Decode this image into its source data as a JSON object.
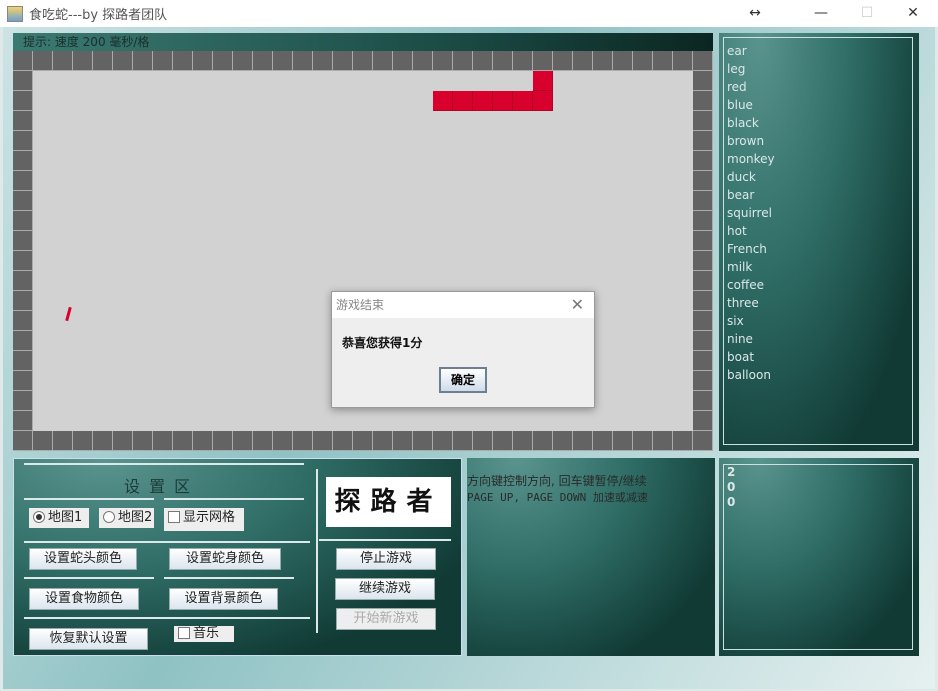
{
  "window": {
    "title": "食吃蛇---by 探路者团队",
    "resize_icon": "↔",
    "minimize_icon": "—",
    "maximize_icon": "☐",
    "close_icon": "✕"
  },
  "hint": "提示: 速度 200 毫秒/格",
  "board": {
    "cols": 35,
    "rows": 20,
    "wall_color": "#636363",
    "bg_color": "#d2d2d2",
    "snake_color": "#d8002c",
    "snake": [
      [
        26,
        1
      ],
      [
        26,
        2
      ],
      [
        25,
        2
      ],
      [
        24,
        2
      ],
      [
        23,
        2
      ],
      [
        22,
        2
      ],
      [
        21,
        2
      ]
    ]
  },
  "words": [
    "ear",
    "leg",
    "red",
    "blue",
    "black",
    "brown",
    "monkey",
    "duck",
    "bear",
    "squirrel",
    "hot",
    "French",
    "milk",
    "coffee",
    "three",
    "six",
    "nine",
    "boat",
    "balloon"
  ],
  "settings": {
    "title": "设 置 区",
    "map1": "地图1",
    "map2": "地图2",
    "show_grid": "显示网格",
    "snake_head_color": "设置蛇头颜色",
    "snake_body_color": "设置蛇身颜色",
    "food_color": "设置食物颜色",
    "bg_color": "设置背景颜色",
    "restore_default": "恢复默认设置",
    "music": "音乐"
  },
  "logo": "探路者",
  "controls": {
    "stop": "停止游戏",
    "resume": "继续游戏",
    "new_game": "开始新游戏"
  },
  "instructions": {
    "line1": "方向键控制方向, 回车键暂停/继续",
    "line2": "PAGE UP, PAGE DOWN 加速或减速"
  },
  "score_digits": [
    "2",
    "0",
    "0"
  ],
  "dialog": {
    "title": "游戏结束",
    "close_icon": "✕",
    "message": "恭喜您获得1分",
    "ok": "确定"
  }
}
